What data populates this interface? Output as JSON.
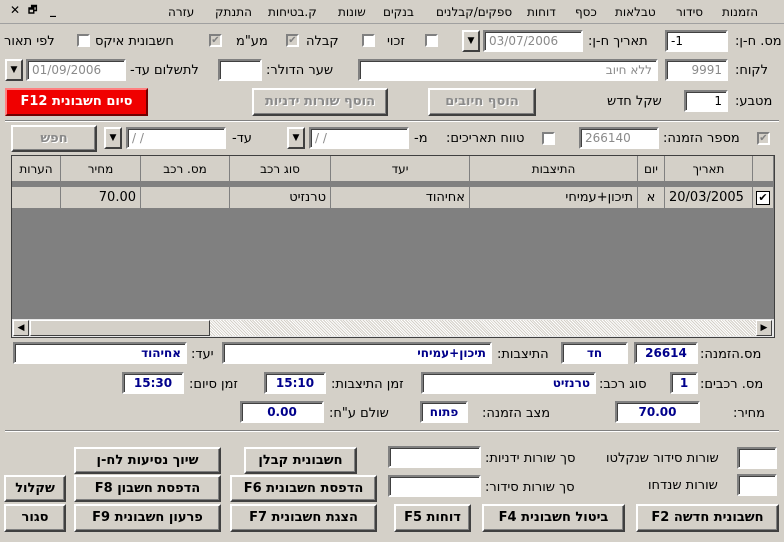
{
  "menubar": {
    "items": [
      "הזמנות",
      "סידור",
      "טבלאות",
      "כסף",
      "דוחות",
      "ספקים/קבלנים",
      "בנקים",
      "שונות",
      "ק.בטיחות",
      "התנתק",
      "עזרה"
    ],
    "window_controls": [
      "✕",
      "🗗",
      "_"
    ]
  },
  "header": {
    "invoice_no_label": "מס. ח-ן:",
    "invoice_no": "-1",
    "invoice_date_label": "תאריך ח-ן:",
    "invoice_date": "03/07/2006",
    "customer_label": "לקוח:",
    "customer_code": "9991",
    "customer_name": "ללא חיוב",
    "dollar_rate_label": "שער הדולר:",
    "dollar_rate": "",
    "pay_until_label": "לתשלום עד-",
    "pay_until": "01/09/2006",
    "currency_label": "מטבע:",
    "currency_code": "1",
    "currency_name": "שקל חדש",
    "options": {
      "credit_label": "זכוי",
      "receipt_label": "קבלה",
      "vat_label": "מע\"מ",
      "export_label": "חשבונית איקס",
      "by_desc_label": "לפי תאור"
    }
  },
  "buttons": {
    "add_charges": "הוסף חיובים",
    "add_manual_rows": "הוסף שורות ידניות",
    "finish_invoice": "סיום חשבונית F12"
  },
  "filter": {
    "order_no_label": "מספר הזמנה:",
    "order_no": "266140",
    "date_range_label": "טווח תאריכים:",
    "from_label": "מ-",
    "from_value": "/ /",
    "to_label": "עד-",
    "to_value": "/ /",
    "search_label": "חפש"
  },
  "grid": {
    "columns": [
      "תאריך",
      "יום",
      "התיצבות",
      "יעד",
      "סוג רכב",
      "מס. רכב",
      "מחיר",
      "הערות"
    ],
    "rows": [
      {
        "checked": true,
        "date": "20/03/2005",
        "day": "א",
        "meeting": "תיכון+עמיחי",
        "destination": "אחיהוד",
        "vehicle_type": "טרנזיט",
        "vehicle_no": "",
        "price": "70.00",
        "notes": ""
      }
    ]
  },
  "details": {
    "order_label": "מס.הזמנה:",
    "order": "26614",
    "meeting_label": "התיצבות:",
    "trip_kind": "חד",
    "meeting": "תיכון+עמיחי",
    "destination_label": "יעד:",
    "destination": "אחיהוד",
    "vehicles_label": "מס. רכבים:",
    "vehicles": "1",
    "vehicle_type_label": "סוג רכב:",
    "vehicle_type": "טרנזיט",
    "meeting_time_label": "זמן התיצבות:",
    "meeting_time": "15:10",
    "end_time_label": "זמן סיום:",
    "end_time": "15:30",
    "price_label": "מחיר:",
    "price": "70.00",
    "status_label": "מצב הזמנה:",
    "status": "פתוח",
    "paid_label": "שולם ע\"ח:",
    "paid": "0.00"
  },
  "summary": {
    "captured_rows_label": "שורות סידור שנקלטו",
    "deleted_rows_label": "שורות שנדחו",
    "manual_rows_label": "סך שורות ידניות:",
    "order_rows_label": "סך שורות סידור:"
  },
  "actions": {
    "new_invoice": "חשבונית חדשה F2",
    "cancel_invoice": "ביטול חשבונית F4",
    "reports": "דוחות F5",
    "show_invoice": "הצגת חשבונית F7",
    "print_invoice": "הדפסת חשבונית F6",
    "contractor_invoice": "חשבונית קבלן",
    "redeem_invoice": "פרעון חשבונית F9",
    "print_account": "הדפסת חשבון F8",
    "assign_trips": "שיוך נסיעות לח-ן",
    "close": "סגור",
    "shekel": "שקלול"
  }
}
